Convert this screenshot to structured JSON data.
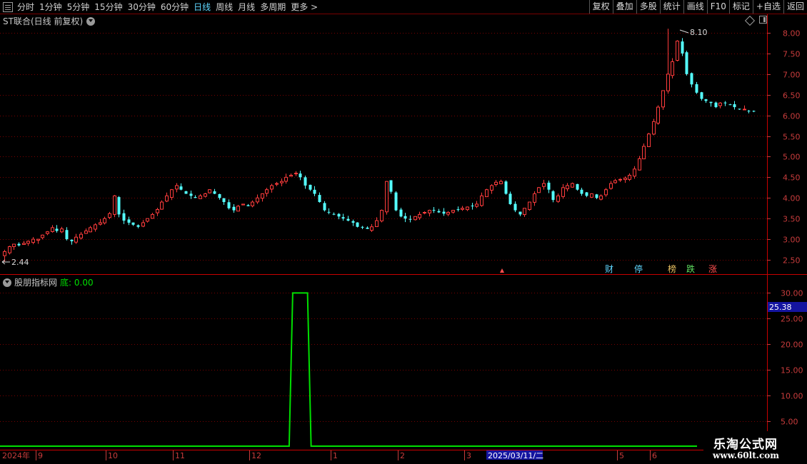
{
  "toolbar": {
    "periods": [
      "分时",
      "1分钟",
      "5分钟",
      "15分钟",
      "30分钟",
      "60分钟",
      "日线",
      "周线",
      "月线",
      "多周期",
      "更多 >"
    ],
    "active_period": "日线",
    "buttons": [
      "复权",
      "叠加",
      "多股",
      "统计",
      "画线",
      "F10",
      "标记",
      "+自选",
      "返回"
    ]
  },
  "main_chart": {
    "title": "ST联合(日线 前复权)",
    "high_label": "8.10",
    "low_label": "2.44",
    "y_ticks": [
      "8.00",
      "7.50",
      "7.00",
      "6.50",
      "6.00",
      "5.50",
      "5.00",
      "4.50",
      "4.00",
      "3.50",
      "3.00",
      "2.50"
    ],
    "markers": [
      {
        "text": "财",
        "color": "#5fd7ff"
      },
      {
        "text": "停",
        "color": "#5fd7ff"
      },
      {
        "text": "榜",
        "color": "#e8c060"
      },
      {
        "text": "跌",
        "color": "#60e060"
      },
      {
        "text": "涨",
        "color": "#ff5050"
      }
    ]
  },
  "sub_chart": {
    "name": "股朋指标网",
    "label": "底: 0.00",
    "y_ticks": [
      "30.00",
      "25.00",
      "20.00",
      "15.00",
      "10.00",
      "5.00"
    ],
    "current_value": "25.38"
  },
  "x_axis": {
    "year_label": "2024年",
    "months": [
      "9",
      "10",
      "11",
      "12",
      "1",
      "2",
      "3",
      "5",
      "6"
    ],
    "cursor_date": "2025/03/11/二"
  },
  "watermark": {
    "name": "乐淘公式网",
    "url": "www.60lt.com"
  },
  "colors": {
    "up": "#ff3c3c",
    "down": "#54ffff",
    "grid": "#7a0000",
    "indicator": "#00e000",
    "axis": "#c83c3c"
  },
  "chart_data": {
    "type": "candlestick",
    "ylim": [
      2.3,
      8.3
    ],
    "close_prices": [
      2.7,
      2.82,
      2.88,
      2.85,
      2.9,
      2.95,
      3.0,
      3.0,
      3.1,
      3.18,
      3.28,
      3.2,
      3.25,
      3.0,
      2.95,
      3.05,
      3.12,
      3.2,
      3.28,
      3.35,
      3.4,
      3.5,
      3.62,
      4.05,
      3.6,
      3.45,
      3.4,
      3.35,
      3.3,
      3.4,
      3.5,
      3.6,
      3.72,
      3.9,
      4.05,
      4.2,
      4.3,
      4.2,
      4.1,
      4.05,
      4.0,
      4.05,
      4.1,
      4.2,
      4.1,
      4.0,
      3.9,
      3.75,
      3.7,
      3.8,
      3.85,
      3.8,
      3.9,
      4.0,
      4.1,
      4.2,
      4.3,
      4.35,
      4.4,
      4.5,
      4.55,
      4.6,
      4.5,
      4.3,
      4.2,
      4.1,
      3.9,
      3.7,
      3.65,
      3.6,
      3.55,
      3.5,
      3.45,
      3.4,
      3.3,
      3.28,
      3.25,
      3.3,
      3.45,
      3.7,
      4.4,
      4.15,
      3.7,
      3.55,
      3.5,
      3.48,
      3.55,
      3.6,
      3.65,
      3.7,
      3.7,
      3.65,
      3.62,
      3.65,
      3.7,
      3.72,
      3.75,
      3.78,
      3.8,
      3.85,
      4.05,
      4.2,
      4.3,
      4.38,
      4.4,
      4.1,
      3.85,
      3.7,
      3.6,
      3.75,
      3.9,
      4.1,
      4.25,
      4.35,
      4.2,
      3.95,
      4.05,
      4.25,
      4.3,
      4.35,
      4.2,
      4.1,
      4.05,
      4.1,
      4.0,
      4.05,
      4.2,
      4.35,
      4.42,
      4.45,
      4.48,
      4.55,
      4.7,
      4.95,
      5.25,
      5.55,
      5.85,
      6.2,
      6.6,
      7.0,
      7.3,
      7.8,
      7.5,
      7.0,
      6.75,
      6.55,
      6.4,
      6.35,
      6.3,
      6.2,
      6.3,
      6.3,
      6.25,
      6.2,
      6.15,
      6.15,
      6.1,
      6.1
    ],
    "daily_high": 8.1,
    "daily_low": 2.44,
    "indicator": {
      "name": "股朋指标网",
      "values_peak": 30,
      "peak_index_range": [
        60,
        64
      ],
      "ylim": [
        0,
        32
      ]
    }
  }
}
